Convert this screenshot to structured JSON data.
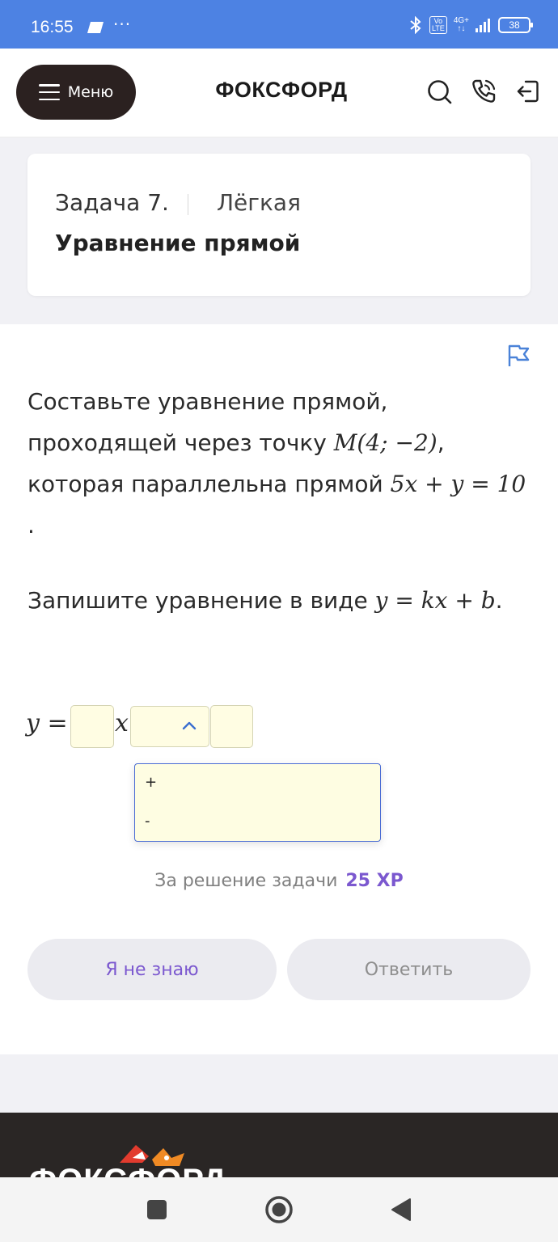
{
  "status_bar": {
    "time": "16:55",
    "dots": "···",
    "volte": "Vo\nLTE",
    "network": "4G+",
    "battery": "38",
    "color": "#4d82e3"
  },
  "header": {
    "menu_label": "Меню",
    "logo": "ФОКСФОРД",
    "icons": [
      "search-icon",
      "phone-icon",
      "logout-icon"
    ]
  },
  "task": {
    "number": "Задача 7.",
    "difficulty": "Лёгкая",
    "title": "Уравнение прямой"
  },
  "problem": {
    "text_1": "Составьте уравнение прямой, проходящей через точку ",
    "point": "M(4; −2)",
    "text_2": ", которая параллельна прямой ",
    "line_eq": "5x + y = 10",
    "text_3": ".",
    "instruction_text": "Запишите уравнение в виде ",
    "form": "y = kx + b",
    "instruction_end": "."
  },
  "answer": {
    "y_equals": "y =",
    "x": "x",
    "k_value": "",
    "sign_value": "",
    "b_value": "",
    "sign_options": [
      "+",
      "-"
    ]
  },
  "reward": {
    "label": "За решение задачи",
    "xp": "25 XP"
  },
  "buttons": {
    "dont_know": "Я не знаю",
    "answer": "Ответить"
  },
  "footer": {
    "logo": "ФОКСФОРД"
  },
  "colors": {
    "accent_purple": "#7b58cf",
    "dark": "#2b2120",
    "input_bg": "#fffde3",
    "dropdown_border": "#4a6cd4"
  }
}
